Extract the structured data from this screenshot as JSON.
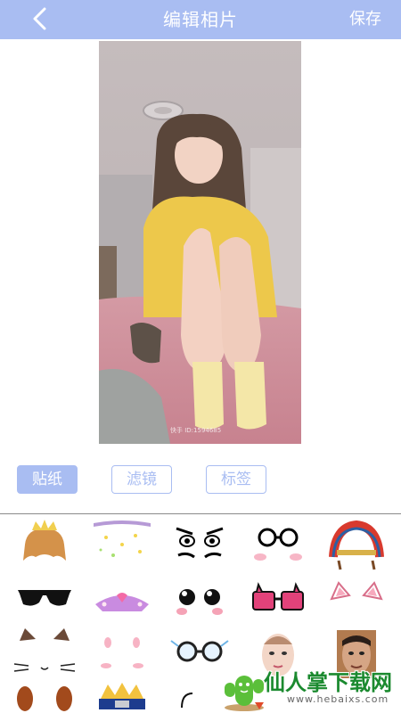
{
  "header": {
    "title": "编辑相片",
    "save_label": "保存"
  },
  "photo": {
    "watermark": "快手 ID:1594685"
  },
  "tabs": [
    {
      "label": "贴纸",
      "active": true
    },
    {
      "label": "滤镜",
      "active": false
    },
    {
      "label": "标签",
      "active": false
    }
  ],
  "stickers": [
    "crown-wig-sticker",
    "falling-stars-sticker",
    "angry-eyes-sticker",
    "glasses-blush-sticker",
    "feather-headdress-sticker",
    "sunglasses-sticker",
    "pink-crown-sticker",
    "cute-eyes-sticker",
    "heart-glasses-sticker",
    "pink-cat-ears-sticker",
    "cat-ears-whiskers-sticker",
    "bunny-blush-sticker",
    "round-glasses-sticker",
    "female-face-sticker",
    "male-face-sticker",
    "dog-ears-sticker",
    "ninja-headband-sticker",
    "curl-sticker"
  ],
  "watermark_logo": {
    "name": "仙人掌下载网",
    "url": "www.hebaixs.com"
  },
  "colors": {
    "accent": "#a9bdf2"
  }
}
